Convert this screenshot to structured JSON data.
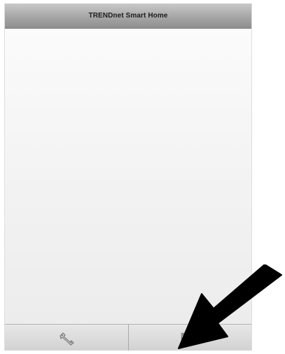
{
  "header": {
    "title": "TRENDnet Smart Home"
  },
  "tab_bar": {
    "tabs": [
      {
        "icon": "wrench-icon"
      },
      {
        "icon": "window-icon"
      }
    ]
  },
  "annotation": {
    "icon": "arrow-icon",
    "color": "#000000"
  }
}
